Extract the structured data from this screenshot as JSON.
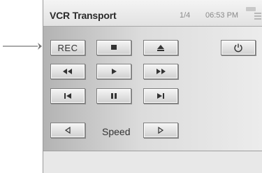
{
  "window": {
    "title": "VCR Transport",
    "page_indicator": "1/4",
    "time": "06:53 PM"
  },
  "buttons": {
    "record_label": "REC",
    "stop_icon": "stop-square",
    "eject_icon": "eject-triangle",
    "power_icon": "power-symbol",
    "rewind_icon": "double-left-triangle",
    "play_icon": "play-triangle",
    "fast_forward_icon": "double-right-triangle",
    "skip_back_icon": "bar-left-triangle",
    "pause_icon": "two-bars",
    "skip_forward_icon": "right-triangle-bar",
    "speed_down_icon": "outline-left-triangle",
    "speed_up_icon": "outline-right-triangle"
  },
  "speed_label": "Speed",
  "colors": {
    "panel_gradient_start": "#b3b3b3",
    "panel_gradient_end": "#ececec",
    "button_face": "#e6e6e6"
  }
}
